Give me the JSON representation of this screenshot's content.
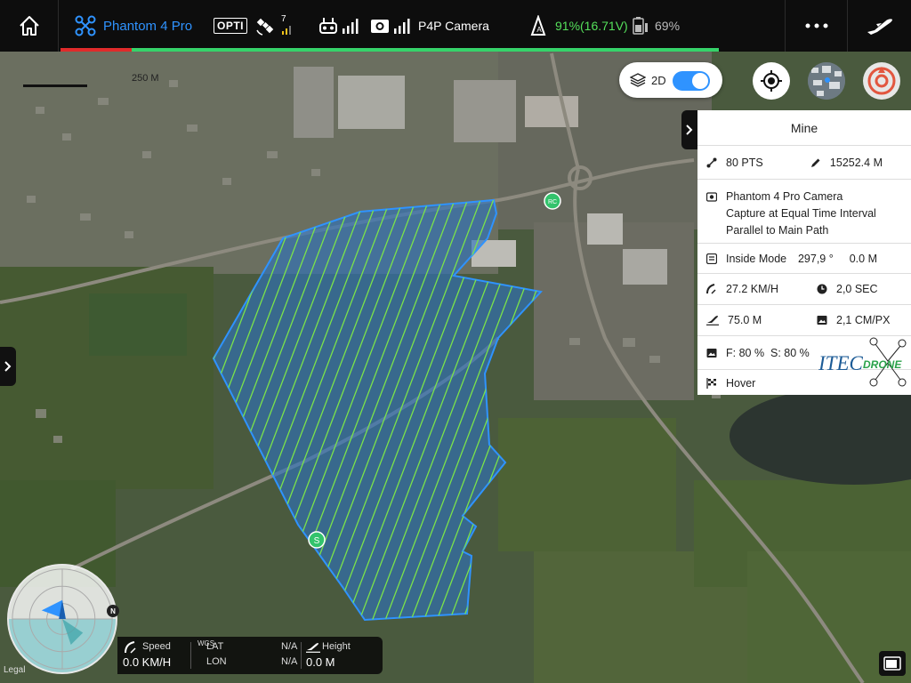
{
  "topbar": {
    "home_icon": "home-icon",
    "drone_icon": "drone-icon",
    "drone_name": "Phantom 4 Pro",
    "vision_label": "OPTI",
    "satellite_count": "7",
    "camera_label": "P4P Camera",
    "battery_value": "91%(16.71V)",
    "device_battery": "69%",
    "more_icon": "more-icon",
    "mode_icon": "airplane-icon",
    "accent_color": "#2f93ff",
    "battery_color": "#55e05b"
  },
  "map": {
    "scale_label": "250 M",
    "start_marker": "S",
    "rc_marker": "RC",
    "legal": "Legal",
    "polygon_fill": "#2f6fb0",
    "grid_color": "#7be34a"
  },
  "view_toggle": {
    "label": "2D",
    "enabled": true
  },
  "panel": {
    "title": "Mine",
    "points": "80 PTS",
    "distance": "15252.4 M",
    "camera_lines": [
      "Phantom 4 Pro Camera",
      "Capture at Equal Time Interval",
      "Parallel to Main Path"
    ],
    "mode": "Inside Mode",
    "heading": "297,9 °",
    "offset": "0.0 M",
    "speed": "27.2 KM/H",
    "interval": "2,0 SEC",
    "altitude": "75.0 M",
    "gsd": "2,1 CM/PX",
    "overlap": "F: 80 %  S: 80 %",
    "finish_action": "Hover",
    "logo_text_1": "ITEC",
    "logo_text_2": "DRONE"
  },
  "radar": {
    "north": "N"
  },
  "telemetry": {
    "speed_label": "Speed",
    "speed_value": "0.0 KM/H",
    "wgs_label": "WGS",
    "lat_label": "LAT",
    "lon_label": "LON",
    "lat_value": "N/A",
    "lon_value": "N/A",
    "height_label": "Height",
    "height_value": "0.0 M"
  }
}
